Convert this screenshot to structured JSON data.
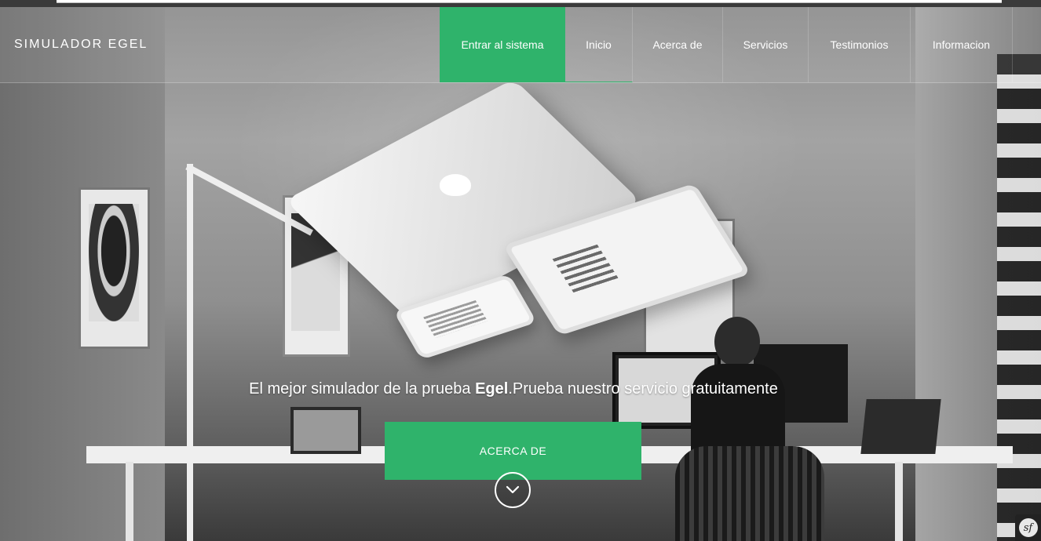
{
  "brand": {
    "title": "SIMULADOR EGEL"
  },
  "nav": {
    "items": [
      {
        "label": "Entrar al sistema",
        "active": true
      },
      {
        "label": "Inicio"
      },
      {
        "label": "Acerca de"
      },
      {
        "label": "Servicios"
      },
      {
        "label": "Testimonios"
      },
      {
        "label": "Informacion"
      }
    ]
  },
  "hero": {
    "tagline_pre": "El mejor simulador de la prueba ",
    "tagline_bold": "Egel",
    "tagline_post": ".Prueba nuestro servicio gratuitamente",
    "cta_label": "ACERCA DE"
  },
  "icons": {
    "scroll": "chevron-down-icon",
    "badge": "symfony-icon"
  },
  "colors": {
    "accent": "#2fb36b",
    "text": "#ffffff"
  }
}
